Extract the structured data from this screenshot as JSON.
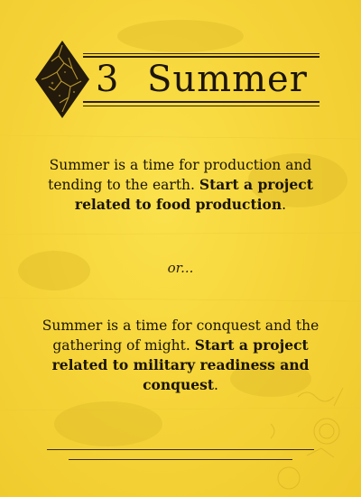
{
  "card": {
    "number": "3",
    "title": "Summer",
    "colors": {
      "background": "#f6d53a",
      "ink": "#1c150a"
    },
    "icons": {
      "emblem": "cracked-diamond-icon"
    },
    "option_one": {
      "text": "Summer is a time for production and tending to the earth.",
      "action": "Start a project related to food production",
      "end": "."
    },
    "divider": "or...",
    "option_two": {
      "text": "Summer is a time for conquest and the gathering of might.",
      "action": "Start a project related to military readiness and conquest",
      "end": "."
    }
  }
}
